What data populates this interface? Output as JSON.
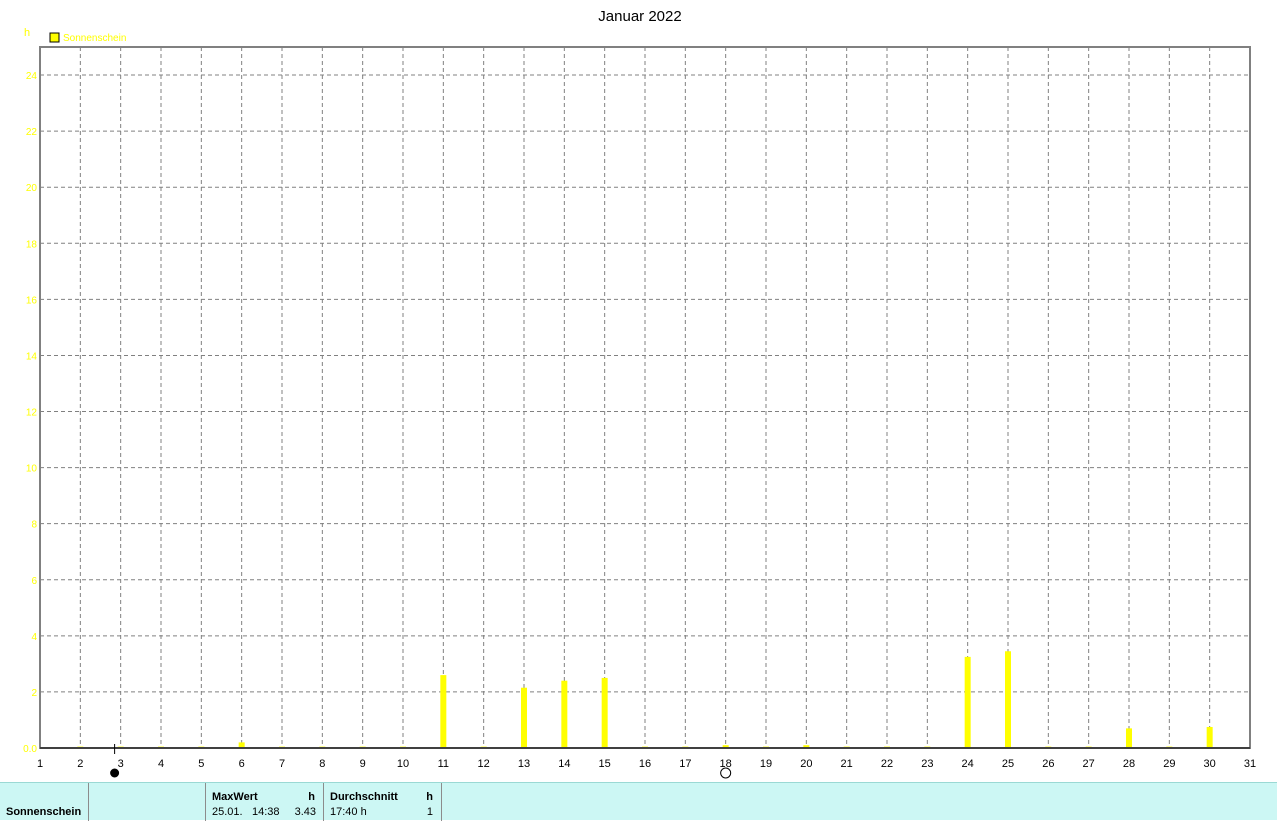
{
  "colors": {
    "sunshine": "#ffff00",
    "grid": "#808080",
    "stats_background": "#ccf7f4"
  },
  "chart_data": {
    "type": "bar",
    "title": "Januar 2022",
    "ylabel": "h",
    "xlabel": "",
    "ylim": [
      0,
      25
    ],
    "yticks": [
      0,
      2,
      4,
      6,
      8,
      10,
      12,
      14,
      16,
      18,
      20,
      22,
      24
    ],
    "ytick_labels": [
      "0.0",
      "2",
      "4",
      "6",
      "8",
      "10",
      "12",
      "14",
      "16",
      "18",
      "20",
      "22",
      "24"
    ],
    "xlim": [
      1,
      31
    ],
    "xticks": [
      1,
      2,
      3,
      4,
      5,
      6,
      7,
      8,
      9,
      10,
      11,
      12,
      13,
      14,
      15,
      16,
      17,
      18,
      19,
      20,
      21,
      22,
      23,
      24,
      25,
      26,
      27,
      28,
      29,
      30,
      31
    ],
    "grid": true,
    "legend_position": "top-left",
    "series": [
      {
        "name": "Sonnenschein",
        "x": [
          2,
          3,
          4,
          5,
          6,
          7,
          8,
          9,
          10,
          11,
          12,
          13,
          14,
          15,
          16,
          17,
          18,
          19,
          20,
          21,
          22,
          23,
          24,
          25,
          26,
          27,
          28,
          29,
          30
        ],
        "values": [
          0.05,
          0.05,
          0.05,
          0.05,
          0.2,
          0.05,
          0.05,
          0.05,
          0.05,
          2.6,
          0.05,
          2.15,
          2.4,
          2.5,
          0.05,
          0.05,
          0.1,
          0.05,
          0.1,
          0.05,
          0.05,
          0.05,
          3.25,
          3.45,
          0.05,
          0.05,
          0.7,
          0.05,
          0.75
        ]
      }
    ],
    "moon_phases": [
      {
        "day": 2.85,
        "phase": "new-moon"
      },
      {
        "day": 18.0,
        "phase": "full-moon"
      }
    ],
    "marker_day": 2.85
  },
  "stats": {
    "row_label": "Sonnenschein",
    "max_header": "MaxWert",
    "max_unit": "h",
    "max_date": "25.01.",
    "max_time": "14:38",
    "max_value": "3.43",
    "avg_header": "Durchschnitt",
    "avg_unit": "h",
    "avg_value": "17:40 h",
    "avg_count": "1"
  }
}
